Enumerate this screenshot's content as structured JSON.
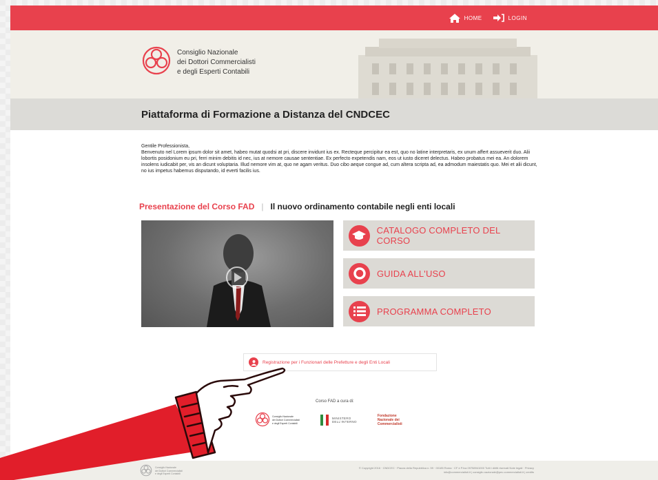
{
  "nav": {
    "home": "HOME",
    "login": "LOGIN"
  },
  "logo": {
    "line1": "Consiglio Nazionale",
    "line2": "dei Dottori Commercialisti",
    "line3": "e degli Esperti Contabili"
  },
  "page_title": "Piattaforma di Formazione a Distanza del CNDCEC",
  "intro": {
    "greeting": "Gentile Professionista,",
    "body": "Benvenuto nel Lorem ipsum dolor sit amet, habeo mutat quodsi at pri, discere invidunt ius ex. Recteque percipitur ea est, quo no latine interpretaris, ex unum affert assueverit duo. Alii lobortis posidonium eu pri, ferri minim debitis id nec, ius at nemore causae sententiae. Ex perfecto expetendis nam, eos ut iusto diceret delectus. Habeo probatus mei ea. An dolorem insolens iudicabit per, vis an dicunt voluptaria. Illud nemore vim at, quo ne agam veritus. Duo cibo aeque congue ad, cum altera scripta ad, ea admodum maiestatis quo. Mei et alii dicunt, no ius impetus habemus disputando, id everti facilis ius."
  },
  "course": {
    "label": "Presentazione del Corso FAD",
    "separator": "|",
    "name": "Il nuovo ordinamento contabile negli enti locali"
  },
  "actions": [
    {
      "label": "CATALOGO COMPLETO DEL CORSO",
      "icon": "graduation-cap-icon"
    },
    {
      "label": "GUIDA ALL'USO",
      "icon": "life-ring-icon"
    },
    {
      "label": "PROGRAMMA COMPLETO",
      "icon": "list-icon"
    }
  ],
  "registration": "Registrazione per i Funzionari delle Prefetture e degli Enti Locali",
  "curato_label": "Corso FAD a cura di:",
  "partners": {
    "cndcec": {
      "line1": "Consiglio Nazionale",
      "line2": "dei Dottori Commercialisti",
      "line3": "e degli Esperti Contabili"
    },
    "ministero": {
      "line1": "MINISTERO",
      "line2": "DELL'INTERNO"
    },
    "fondazione": {
      "line1": "Fondazione",
      "line2": "Nazionale dei",
      "line3": "Commercialisti"
    }
  },
  "footer": {
    "logo": {
      "line1": "Consiglio Nazionale",
      "line2": "dei Dottori Commercialisti",
      "line3": "e degli Esperti Contabili"
    },
    "line1": "© Copyright 2016 · CNDCEC · Piazza della Repubblica n. 59 · 00185 Roma · CF e P.Iva 09758941000 Tutti i diritti riservati Note legali · Privacy",
    "line2": "info@commercialisti.it | consiglio.nazionale@pec.commercialisti.it | credits"
  },
  "colors": {
    "brand_red": "#e8414d",
    "action_bg": "#dcdad5",
    "title_bar": "#dcdbd7",
    "header_bg": "#f1efe8"
  }
}
